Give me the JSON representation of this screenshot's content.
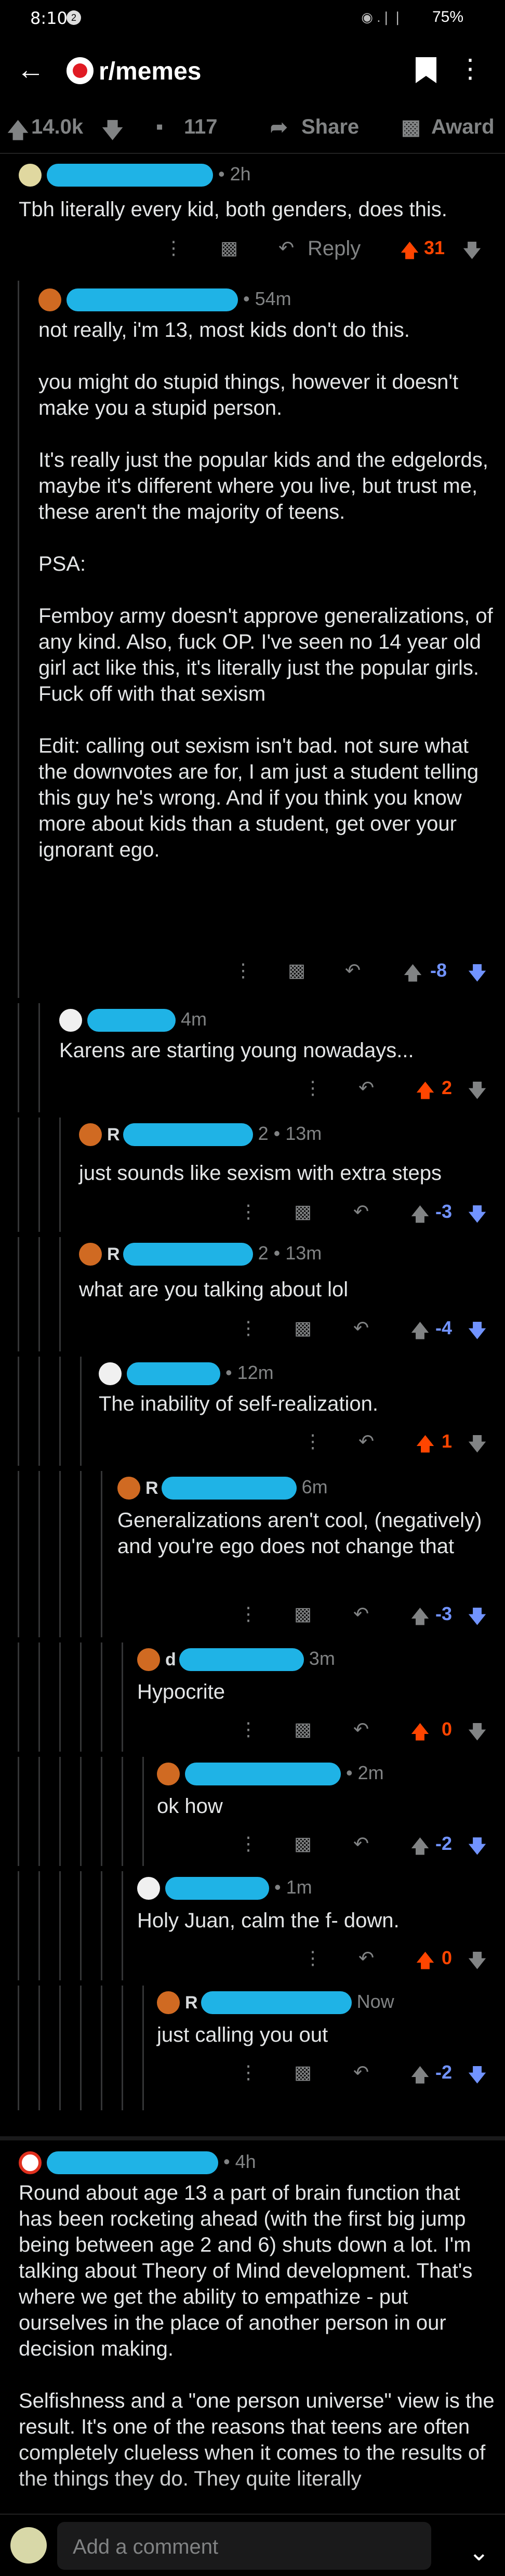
{
  "status": {
    "time": "8:10",
    "notif": "2",
    "battery": "75%",
    "signal": "◉ .❘❘"
  },
  "header": {
    "subreddit": "r/memes"
  },
  "post_actions": {
    "upvotes": "14.0k",
    "comments": "117",
    "share": "Share",
    "award": "Award"
  },
  "comments": [
    {
      "age": "• 2h",
      "body": "Tbh literally every kid, both genders, does this.",
      "reply": "Reply",
      "votes": "31"
    },
    {
      "age": "• 54m",
      "body": "not really, i'm 13, most kids don't do this.\n\nyou might do stupid things, however it doesn't make you a stupid person.\n\nIt's really just the popular kids and the edgelords, maybe it's different where you live, but trust me, these aren't the majority of teens.\n\nPSA:\n\nFemboy army doesn't approve generalizations, of any kind. Also, fuck OP. I've seen no 14 year old girl act like this, it's literally just the popular girls. Fuck off with that sexism\n\nEdit: calling out sexism isn't bad. not sure what the downvotes are for, I am just a student telling this guy he's wrong. And if you think you know more about kids than a student, get over your ignorant ego.",
      "votes": "-8"
    },
    {
      "age": "4m",
      "body": "Karens are starting young nowadays...",
      "votes": "2"
    },
    {
      "name_prefix": "R",
      "age": "2 • 13m",
      "body": "just sounds like sexism with extra steps",
      "votes": "-3"
    },
    {
      "name_prefix": "R",
      "age": "2 • 13m",
      "body": "what are you talking about lol",
      "votes": "-4"
    },
    {
      "age": "• 12m",
      "body": "The inability of self-realization.",
      "votes": "1"
    },
    {
      "name_prefix": "R",
      "age": "6m",
      "body": "Generalizations aren't cool, (negatively) and you're ego does not change that",
      "votes": "-3"
    },
    {
      "name_prefix": "d",
      "age": "3m",
      "body": "Hypocrite",
      "votes": "0"
    },
    {
      "age": "• 2m",
      "body": "ok how",
      "votes": "-2"
    },
    {
      "age": "• 1m",
      "body": "Holy Juan, calm the f- down.",
      "votes": "0"
    },
    {
      "name_prefix": "R",
      "age": "Now",
      "body": "just calling you out",
      "votes": "-2"
    },
    {
      "age": "• 4h",
      "body": "Round about age 13 a part of brain function that has been rocketing ahead (with the first big jump being between age 2 and 6) shuts down a lot. I'm talking about Theory of Mind development. That's where we get the ability to empathize - put ourselves in the place of another person in our decision making.\n\nSelfishness and a \"one person universe\" view is the result. It's one of the reasons that teens are often completely clueless when it comes to the results of the things they do. They quite literally"
    }
  ],
  "composer": {
    "placeholder": "Add a comment"
  },
  "colors": {
    "upvote": "#ff4500",
    "downvote": "#7193ff",
    "background": "#000000",
    "redaction": "#1fb3e6"
  }
}
